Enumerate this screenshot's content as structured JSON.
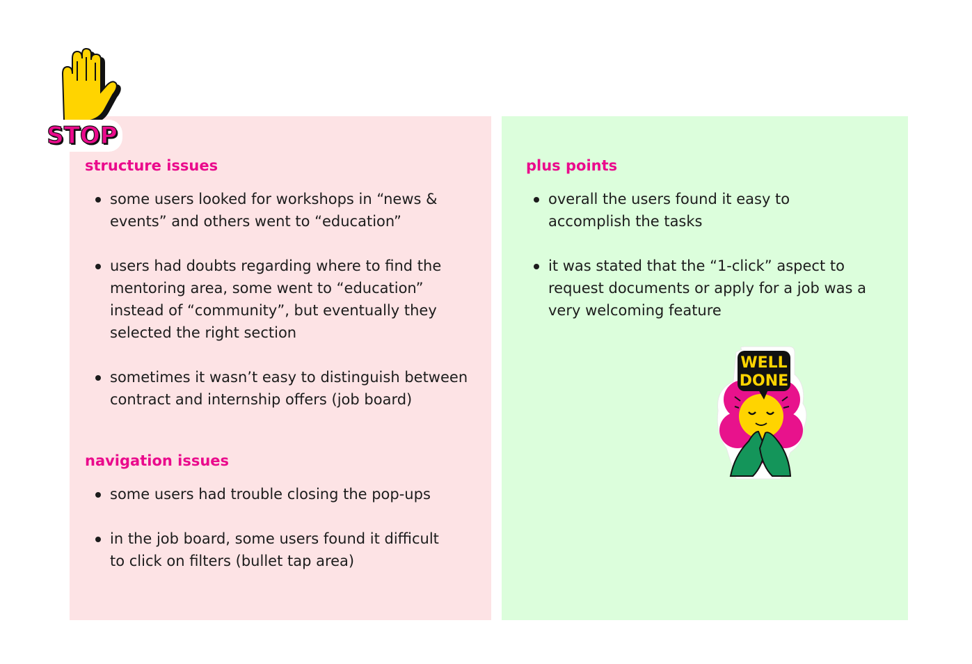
{
  "structure_issues": {
    "heading": "structure issues",
    "items": [
      "some users looked for workshops in “news & events” and others went to “education”",
      "users had doubts regarding where to find the mentoring area, some went to “education” instead of “community”, but eventually they selected the right section",
      "sometimes it wasn’t easy to distinguish between contract and internship offers (job board)"
    ]
  },
  "navigation_issues": {
    "heading": "navigation issues",
    "items": [
      "some users had trouble closing the pop-ups",
      "in the job board, some users found it difficult to click on filters (bullet tap area)"
    ]
  },
  "plus_points": {
    "heading": "plus points",
    "items": [
      "overall the users found it easy to accomplish the tasks",
      "it was stated that the “1-click” aspect to request documents or apply for a job was a very welcoming feature"
    ]
  },
  "stickers": {
    "stop": {
      "text": "STOP",
      "icon": "raised-hand-icon"
    },
    "well_done": {
      "line1": "WELL",
      "line2": "DONE",
      "icon": "clapping-character-icon"
    }
  },
  "colors": {
    "heading": "#ea0a8c",
    "issues_panel": "#fde3e5",
    "plus_panel": "#dcfedc"
  }
}
